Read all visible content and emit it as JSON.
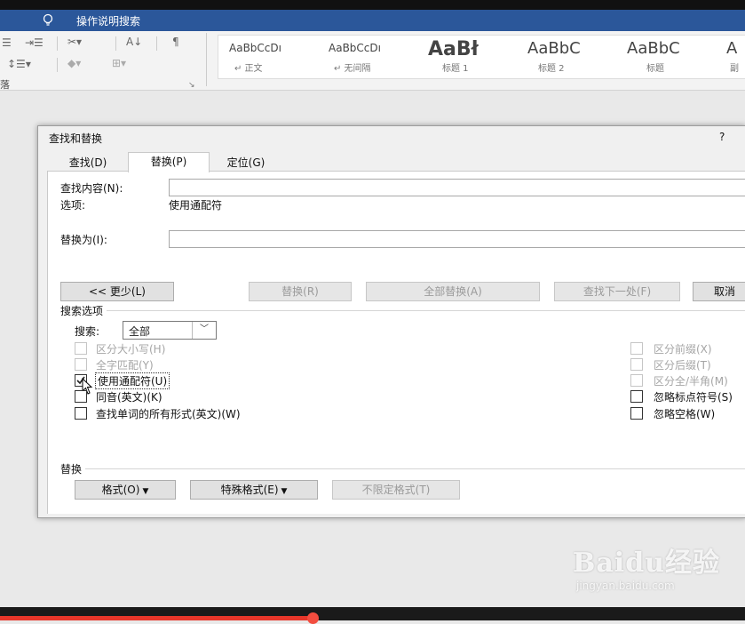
{
  "titlebar": {
    "search_text": "操作说明搜索"
  },
  "ribbon": {
    "paragraph_label": "落",
    "styles": [
      {
        "sample": "AaBbCcDı",
        "name": "↵ 正文",
        "big": false
      },
      {
        "sample": "AaBbCcDı",
        "name": "↵ 无间隔",
        "big": false
      },
      {
        "sample": "AaBł",
        "name": "标题 1",
        "big": true
      },
      {
        "sample": "AaBbC",
        "name": "标题 2",
        "big": "mid"
      },
      {
        "sample": "AaBbC",
        "name": "标题",
        "big": "mid"
      },
      {
        "sample": "A",
        "name": "副",
        "big": "mid"
      }
    ]
  },
  "dialog": {
    "title": "查找和替换",
    "help": "?",
    "tabs": {
      "find": "查找(D)",
      "replace": "替换(P)",
      "goto": "定位(G)"
    },
    "find_label": "查找内容(N):",
    "find_value": "",
    "options_label": "选项:",
    "options_value": "使用通配符",
    "replace_label": "替换为(I):",
    "replace_value": "",
    "buttons": {
      "less": "<< 更少(L)",
      "replace": "替换(R)",
      "replace_all": "全部替换(A)",
      "find_next": "查找下一处(F)",
      "cancel": "取消"
    },
    "search_options_title": "搜索选项",
    "search_label": "搜索:",
    "search_value": "全部",
    "left_options": [
      {
        "label": "区分大小写(H)",
        "checked": false,
        "disabled": true
      },
      {
        "label": "全字匹配(Y)",
        "checked": false,
        "disabled": true
      },
      {
        "label": "使用通配符(U)",
        "checked": true,
        "disabled": false
      },
      {
        "label": "同音(英文)(K)",
        "checked": false,
        "disabled": false
      },
      {
        "label": "查找单词的所有形式(英文)(W)",
        "checked": false,
        "disabled": false
      }
    ],
    "right_options": [
      {
        "label": "区分前缀(X)",
        "checked": false,
        "disabled": true
      },
      {
        "label": "区分后缀(T)",
        "checked": false,
        "disabled": true
      },
      {
        "label": "区分全/半角(M)",
        "checked": false,
        "disabled": true
      },
      {
        "label": "忽略标点符号(S)",
        "checked": false,
        "disabled": false
      },
      {
        "label": "忽略空格(W)",
        "checked": false,
        "disabled": false
      }
    ],
    "replace_section_title": "替换",
    "format_button": "格式(O)",
    "special_button": "特殊格式(E)",
    "no_format_button": "不限定格式(T)"
  },
  "watermark": {
    "brand": "Baidu经验",
    "url": "jingyan.baidu.com"
  },
  "video": {
    "progress": 0.42
  },
  "colors": {
    "titlebar": "#2b579a",
    "progress": "#e8362a"
  }
}
